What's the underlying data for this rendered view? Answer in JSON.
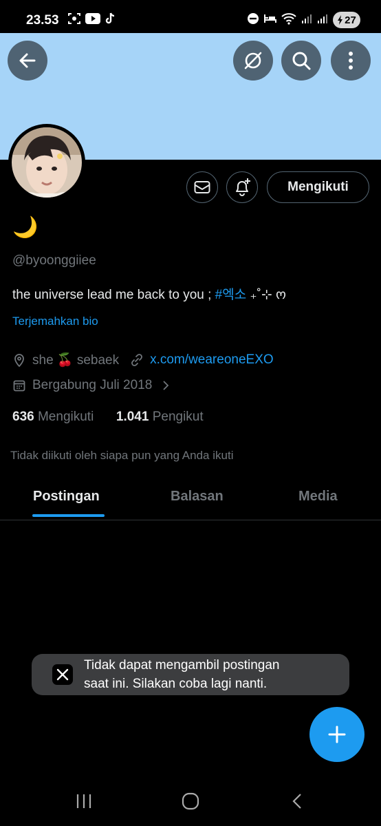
{
  "status_bar": {
    "time": "23.53",
    "battery": "27"
  },
  "header": {
    "back_icon": "arrow-left-icon",
    "hide_icon": "eye-slash-icon",
    "search_icon": "search-icon",
    "more_icon": "more-vertical-icon",
    "banner_color": "#a6d4f8"
  },
  "profile": {
    "display_name": "🌙",
    "handle": "@byoonggiiee",
    "bio_text": "the universe lead me back to you ; ",
    "bio_hashtag": "#엑소",
    "bio_suffix": " ₊˚⊹ ო",
    "translate_label": "Terjemahkan bio",
    "location": "she 🍒 sebaek",
    "website": "x.com/weareoneEXO",
    "joined": "Bergabung Juli 2018",
    "following_count": "636",
    "following_label": "Mengikuti",
    "followers_count": "1.041",
    "followers_label": "Pengikut",
    "not_followed_note": "Tidak diikuti oleh siapa pun yang Anda ikuti"
  },
  "actions": {
    "follow_label": "Mengikuti"
  },
  "tabs": [
    {
      "label": "Postingan",
      "active": true
    },
    {
      "label": "Balasan",
      "active": false
    },
    {
      "label": "Media",
      "active": false
    }
  ],
  "toast": {
    "line1": "Tidak dapat mengambil postingan",
    "line2": "saat ini. Silakan coba lagi nanti."
  },
  "colors": {
    "accent": "#1d9bf0",
    "background": "#000000",
    "muted_text": "#71767b"
  }
}
